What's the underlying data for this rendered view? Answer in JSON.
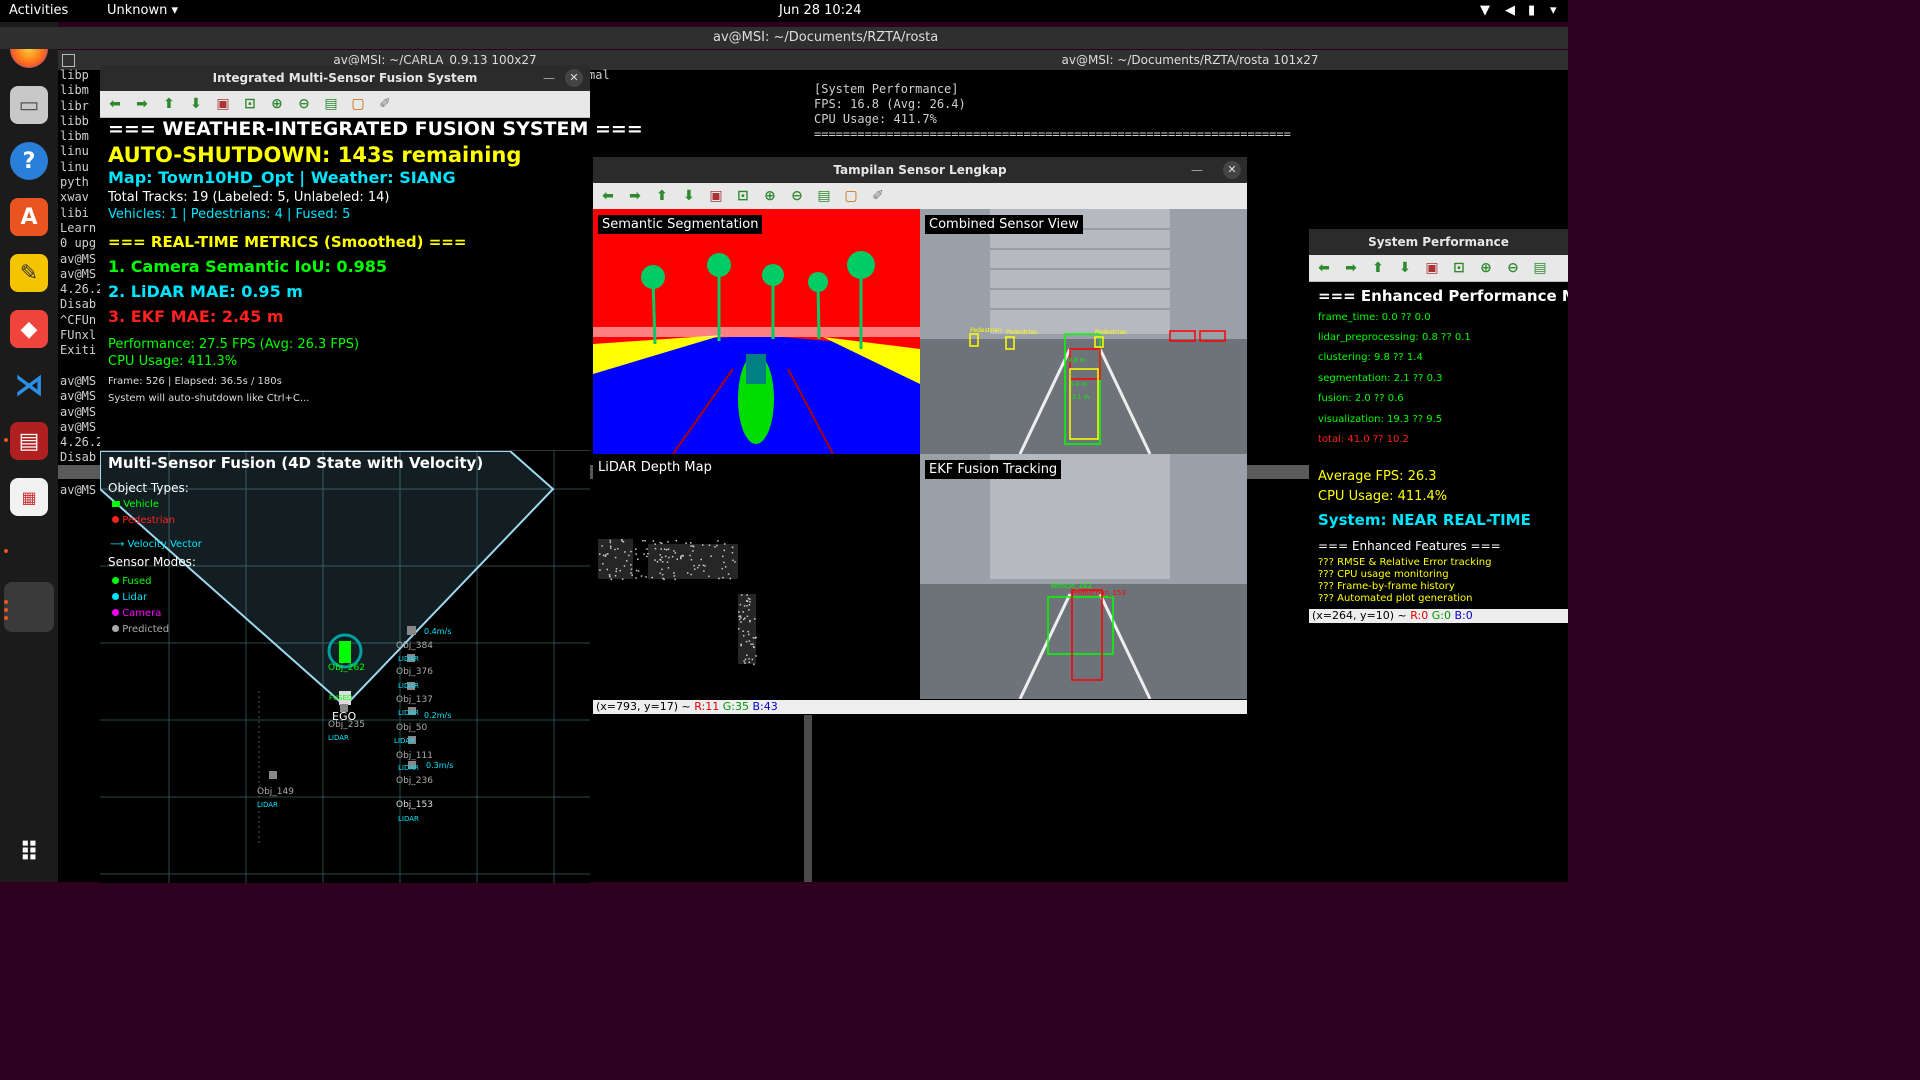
{
  "topbar": {
    "activities": "Activities",
    "app_menu": "Unknown",
    "clock": "Jun 28  10:24"
  },
  "colors": {
    "accent": "#e95420",
    "cyan": "#00e5ff",
    "yellow": "#ffff00",
    "green": "#00ff00",
    "red": "#ff2020"
  },
  "dock": {
    "icons": [
      "firefox-icon",
      "files-icon",
      "help-icon",
      "app-center-icon",
      "text-editor-icon",
      "anydesk-icon",
      "vscode-icon",
      "terminal-app-icon",
      "document-viewer-icon",
      "running-app-icon",
      "app-grid-icon"
    ]
  },
  "terminal_left": {
    "title": "av@MSI: ~/CARLA_0.9.13 100x27",
    "lines": [
      "libp",
      "libm",
      "libr",
      "libb",
      "libm",
      "linu",
      "linu",
      "pyth",
      "xwav",
      "libi",
      "Learn",
      "0 upg",
      "av@MS",
      "av@MS",
      "4.26.2",
      "Disab",
      "^CFUn",
      "FUnxl",
      "Exiti",
      "",
      "av@MS",
      "av@MS",
      "av@MS",
      "av@MS",
      "4.26.2",
      "Disab"
    ],
    "lines2": [
      "av@MS"
    ],
    "frag": "mal"
  },
  "terminal_right": {
    "title": "av@MSI: ~/Documents/RZTA/rosta 101x27",
    "lines": [
      "[System Performance]",
      "FPS: 16.8 (Avg: 26.4)",
      "CPU Usage: 411.7%",
      "=================================================================="
    ]
  },
  "fusion_window": {
    "title": "Integrated Multi-Sensor Fusion System",
    "heading": "=== WEATHER-INTEGRATED FUSION SYSTEM ===",
    "shutdown": "AUTO-SHUTDOWN: 143s remaining",
    "map": "Map: Town10HD_Opt | Weather: SIANG",
    "tracks": "Total Tracks: 19 (Labeled: 5, Unlabeled: 14)",
    "counts": "Vehicles: 1 | Pedestrians: 4 | Fused: 5",
    "metrics_heading": "=== REAL-TIME METRICS (Smoothed) ===",
    "metric1": "1. Camera Semantic IoU: 0.985",
    "metric2": "2. LiDAR MAE: 0.95 m",
    "metric3": "3. EKF MAE: 2.45 m",
    "performance": "Performance: 27.5 FPS (Avg: 26.3 FPS)",
    "cpu": "CPU Usage: 411.3%",
    "frame": "Frame: 526 | Elapsed: 36.5s / 180s",
    "note": "System will auto-shutdown like Ctrl+C...",
    "bev_title": "Multi-Sensor Fusion (4D State with Velocity)",
    "object_types": "Object Types:",
    "legend_vehicle": "Vehicle",
    "legend_pedestrian": "Pedestrian",
    "legend_velocity": "Velocity Vector",
    "sensor_modes": "Sensor Modes:",
    "mode_fused": "Fused",
    "mode_lidar": "Lidar",
    "mode_camera": "Camera",
    "mode_predicted": "Predicted",
    "ego": "EGO",
    "objects": [
      {
        "name": "Obj_384",
        "tag": "LIDAR",
        "vel": "0.4m/s"
      },
      {
        "name": "Obj_376",
        "tag": "LIDAR",
        "vel": ""
      },
      {
        "name": "Obj_137",
        "tag": "LIDAR",
        "vel": "0.2m/s"
      },
      {
        "name": "Obj_50",
        "tag": "LIDAR",
        "vel": ""
      },
      {
        "name": "Obj_111",
        "tag": "LIDAR",
        "vel": "0.3m/s"
      },
      {
        "name": "Obj_236",
        "tag": "",
        "vel": ""
      },
      {
        "name": "Obj_153",
        "tag": "LIDAR",
        "vel": ""
      },
      {
        "name": "Obj_149",
        "tag": "LIDAR",
        "vel": ""
      },
      {
        "name": "Obj_235",
        "tag": "LIDAR",
        "vel": ""
      },
      {
        "name": "Obj_262",
        "tag": "FUSED",
        "vel": ""
      }
    ]
  },
  "sensor_window": {
    "title": "Tampilan Sensor Lengkap",
    "q1": "Semantic Segmentation",
    "q2": "Combined Sensor View",
    "q3": "LiDAR Depth Map",
    "q4": "EKF Fusion Tracking",
    "status_coord": "(x=793, y=17) ~",
    "status_r": "R:11",
    "status_g": "G:35",
    "status_b": "B:43",
    "cam_labels": [
      "Pedestrian",
      "Pedestrian",
      "Pedestrian",
      "Pedestrian",
      "9.8 m",
      "6.8 m",
      "5.0 m",
      "3.1 m"
    ],
    "ekf_labels": [
      "Vehicle_162",
      "Pedestrian_153"
    ]
  },
  "perf_window": {
    "title": "System Performance",
    "heading": "=== Enhanced Performance Me",
    "lines": [
      "frame_time: 0.0 ?? 0.0",
      "lidar_preprocessing: 0.8 ?? 0.1",
      "clustering: 9.8 ?? 1.4",
      "segmentation: 2.1 ?? 0.3",
      "fusion: 2.0 ?? 0.6",
      "visualization: 19.3 ?? 9.5"
    ],
    "total": "total: 41.0 ?? 10.2",
    "avg_fps": "Average FPS: 26.3",
    "cpu": "CPU Usage: 411.4%",
    "system": "System: NEAR REAL-TIME",
    "features_heading": "=== Enhanced Features ===",
    "features": [
      "??? RMSE & Relative Error tracking",
      "??? CPU usage monitoring",
      "??? Frame-by-frame history",
      "??? Automated plot generation"
    ],
    "status_coord": "(x=264, y=10) ~",
    "status_r": "R:0",
    "status_g": "G:0",
    "status_b": "B:0"
  }
}
